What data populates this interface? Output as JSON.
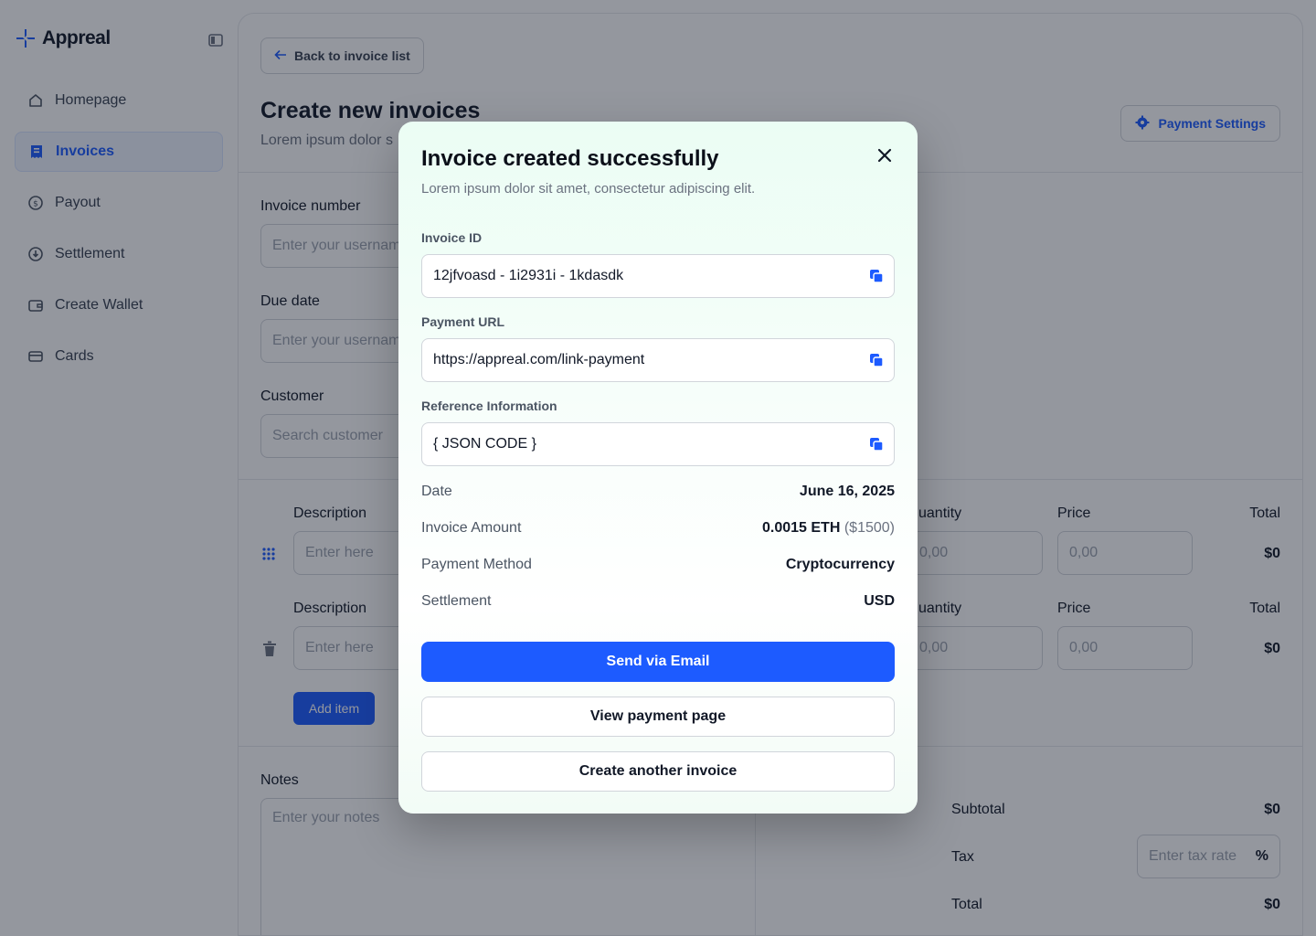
{
  "app": {
    "name": "Appreal"
  },
  "sidebar": {
    "items": [
      {
        "label": "Homepage",
        "icon": "home-icon"
      },
      {
        "label": "Invoices",
        "icon": "receipt-icon",
        "active": true
      },
      {
        "label": "Payout",
        "icon": "dollar-circle-icon"
      },
      {
        "label": "Settlement",
        "icon": "download-circle-icon"
      },
      {
        "label": "Create Wallet",
        "icon": "wallet-icon"
      },
      {
        "label": "Cards",
        "icon": "card-icon"
      }
    ]
  },
  "header": {
    "back_label": "Back to invoice list",
    "title": "Create new invoices",
    "subtitle": "Lorem ipsum dolor s",
    "settings_label": "Payment Settings"
  },
  "form": {
    "invoice_number": {
      "label": "Invoice number",
      "placeholder": "Enter your usernam"
    },
    "due_date": {
      "label": "Due date",
      "placeholder": "Enter your usernam"
    },
    "customer": {
      "label": "Customer",
      "placeholder": "Search customer"
    }
  },
  "items": {
    "rows": [
      {
        "description_label": "Description",
        "description_placeholder": "Enter here",
        "quantity_label": "uantity",
        "quantity_placeholder": "0,00",
        "price_label": "Price",
        "price_placeholder": "0,00",
        "total_label": "Total",
        "total": "$0"
      },
      {
        "description_label": "Description",
        "description_placeholder": "Enter here",
        "quantity_label": "uantity",
        "quantity_placeholder": "0,00",
        "price_label": "Price",
        "price_placeholder": "0,00",
        "total_label": "Total",
        "total": "$0"
      }
    ],
    "add_label": "Add item"
  },
  "notes": {
    "label": "Notes",
    "placeholder": "Enter your notes"
  },
  "summary": {
    "subtotal_label": "Subtotal",
    "subtotal": "$0",
    "tax_label": "Tax",
    "tax_placeholder": "Enter tax rate",
    "tax_unit": "%",
    "total_label": "Total",
    "total": "$0"
  },
  "modal": {
    "title": "Invoice created successfully",
    "subtitle": "Lorem ipsum dolor sit amet, consectetur adipiscing elit.",
    "fields": [
      {
        "label": "Invoice ID",
        "value": "12jfvoasd - 1i2931i - 1kdasdk"
      },
      {
        "label": "Payment URL",
        "value": "https://appreal.com/link-payment"
      },
      {
        "label": "Reference Information",
        "value": "{ JSON CODE }"
      }
    ],
    "details": [
      {
        "key": "Date",
        "value": "June 16, 2025",
        "sub": ""
      },
      {
        "key": "Invoice Amount",
        "value": "0.0015 ETH",
        "sub": "($1500)"
      },
      {
        "key": "Payment Method",
        "value": "Cryptocurrency",
        "sub": ""
      },
      {
        "key": "Settlement",
        "value": "USD",
        "sub": ""
      }
    ],
    "send_label": "Send via Email",
    "view_label": "View payment page",
    "create_label": "Create another invoice"
  },
  "colors": {
    "accent": "#1d5bff",
    "overlay": "rgba(17,24,39,0.45)",
    "modal_tint": "#ebfdf4"
  }
}
